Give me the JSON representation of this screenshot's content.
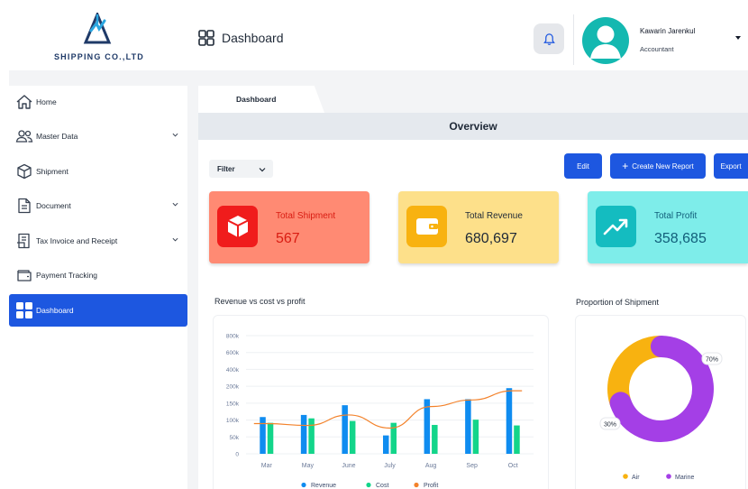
{
  "brand": {
    "name": "SHIPPING CO.,LTD"
  },
  "header": {
    "title": "Dashboard",
    "user_name": "Kawarin Jarenkul",
    "user_role": "Accountant"
  },
  "sidebar": {
    "items": [
      {
        "label": "Home",
        "icon": "home-icon",
        "has_caret": false
      },
      {
        "label": "Master Data",
        "icon": "users-icon",
        "has_caret": true
      },
      {
        "label": "Shipment",
        "icon": "box-icon",
        "has_caret": false
      },
      {
        "label": "Document",
        "icon": "document-icon",
        "has_caret": true
      },
      {
        "label": "Tax Invoice and Receipt",
        "icon": "invoice-icon",
        "has_caret": true
      },
      {
        "label": "Payment Tracking",
        "icon": "wallet-icon",
        "has_caret": false
      },
      {
        "label": "Dashboard",
        "icon": "dashboard-icon",
        "has_caret": false,
        "active": true
      }
    ]
  },
  "tabs": [
    {
      "label": "Dashboard"
    }
  ],
  "overview": {
    "title": "Overview",
    "filter_label": "Filter",
    "buttons": {
      "edit": "Edit",
      "create": "Create New Report",
      "export": "Export"
    }
  },
  "cards": [
    {
      "title": "Total Shipment",
      "value": "567",
      "icon": "cube-icon",
      "color": "#ff8a73"
    },
    {
      "title": "Total Revenue",
      "value": "680,697",
      "icon": "wallet-icon",
      "color": "#fde08a"
    },
    {
      "title": "Total Profit",
      "value": "358,685",
      "icon": "trend-up-icon",
      "color": "#7eedea"
    }
  ],
  "charts_titles": {
    "bar": "Revenue vs cost  vs profit",
    "donut": "Proportion of Shipment"
  },
  "colors": {
    "accent": "#1d57e0",
    "revenue": "#0f8cf0",
    "cost": "#13d58a",
    "profit": "#f3822b",
    "air": "#f8b210",
    "marine": "#a43fe6"
  },
  "chart_data": [
    {
      "type": "bar",
      "title": "Revenue vs cost  vs profit",
      "categories": [
        "Mar",
        "May",
        "June",
        "July",
        "Aug",
        "Sep",
        "Oct"
      ],
      "y_ticks": [
        "0",
        "50k",
        "100k",
        "150k",
        "200k",
        "250k",
        "300k",
        "350k",
        "400k",
        "450k"
      ],
      "tick_labels": [
        "800k",
        "600k",
        "400k",
        "200k",
        "150k",
        "100k",
        "50k",
        "0"
      ],
      "ylim": [
        0,
        450000
      ],
      "series": [
        {
          "name": "Revenue",
          "kind": "bar",
          "values": [
            140000,
            148000,
            185000,
            70000,
            208000,
            208000,
            250000
          ]
        },
        {
          "name": "Cost",
          "kind": "bar",
          "values": [
            118000,
            135000,
            125000,
            118000,
            110000,
            130000,
            108000
          ]
        },
        {
          "name": "Profit",
          "kind": "line",
          "values": [
            115000,
            108000,
            148000,
            98000,
            180000,
            205000,
            240000
          ]
        }
      ],
      "legend": "bottom"
    },
    {
      "type": "pie",
      "title": "Proportion of Shipment",
      "categories": [
        "Air",
        "Marine"
      ],
      "values": [
        30,
        70
      ],
      "labels": [
        "30%",
        "70%"
      ],
      "legend": "bottom"
    }
  ]
}
